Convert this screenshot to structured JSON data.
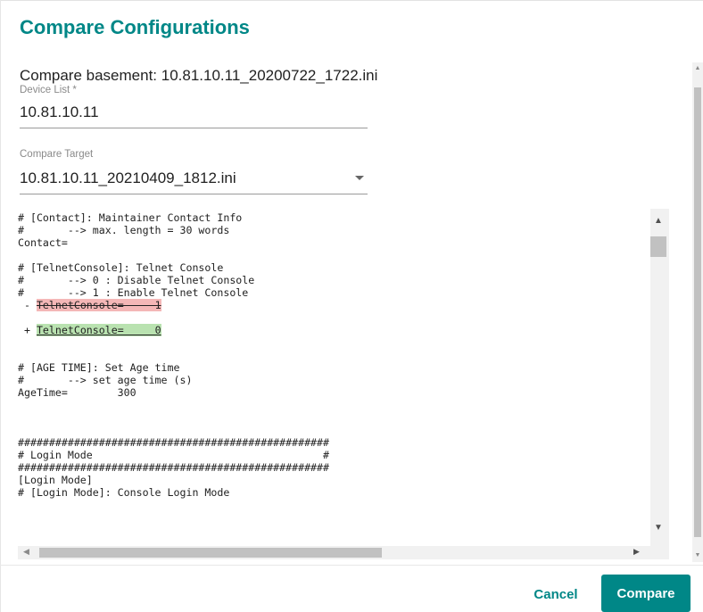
{
  "dialog": {
    "title": "Compare Configurations",
    "basement_label": "Compare basement: 10.81.10.11_20200722_1722.ini"
  },
  "device_list": {
    "label": "Device List *",
    "value": "10.81.10.11"
  },
  "compare_target": {
    "label": "Compare Target",
    "value": "10.81.10.11_20210409_1812.ini"
  },
  "diff_lines": [
    {
      "text": "# [Contact]: Maintainer Contact Info",
      "type": "normal"
    },
    {
      "text": "#       --> max. length = 30 words",
      "type": "normal"
    },
    {
      "text": "Contact=",
      "type": "normal"
    },
    {
      "text": "",
      "type": "normal"
    },
    {
      "text": "# [TelnetConsole]: Telnet Console",
      "type": "normal"
    },
    {
      "text": "#       --> 0 : Disable Telnet Console",
      "type": "normal"
    },
    {
      "text": "#       --> 1 : Enable Telnet Console",
      "type": "normal"
    },
    {
      "text": "TelnetConsole=     1",
      "type": "removed",
      "prefix": " - "
    },
    {
      "text": "",
      "type": "normal"
    },
    {
      "text": "TelnetConsole=     0",
      "type": "added",
      "prefix": " + "
    },
    {
      "text": "",
      "type": "normal"
    },
    {
      "text": "",
      "type": "normal"
    },
    {
      "text": "# [AGE TIME]: Set Age time",
      "type": "normal"
    },
    {
      "text": "#       --> set age time (s)",
      "type": "normal"
    },
    {
      "text": "AgeTime=        300",
      "type": "normal"
    },
    {
      "text": "",
      "type": "normal"
    },
    {
      "text": "",
      "type": "normal"
    },
    {
      "text": "",
      "type": "normal"
    },
    {
      "text": "##################################################",
      "type": "normal"
    },
    {
      "text": "# Login Mode                                     #",
      "type": "normal"
    },
    {
      "text": "##################################################",
      "type": "normal"
    },
    {
      "text": "[Login Mode]",
      "type": "normal"
    },
    {
      "text": "# [Login Mode]: Console Login Mode",
      "type": "normal"
    }
  ],
  "buttons": {
    "cancel": "Cancel",
    "compare": "Compare"
  },
  "colors": {
    "accent": "#008787",
    "removed_bg": "#f4b7b7",
    "added_bg": "#b9e2b0"
  }
}
